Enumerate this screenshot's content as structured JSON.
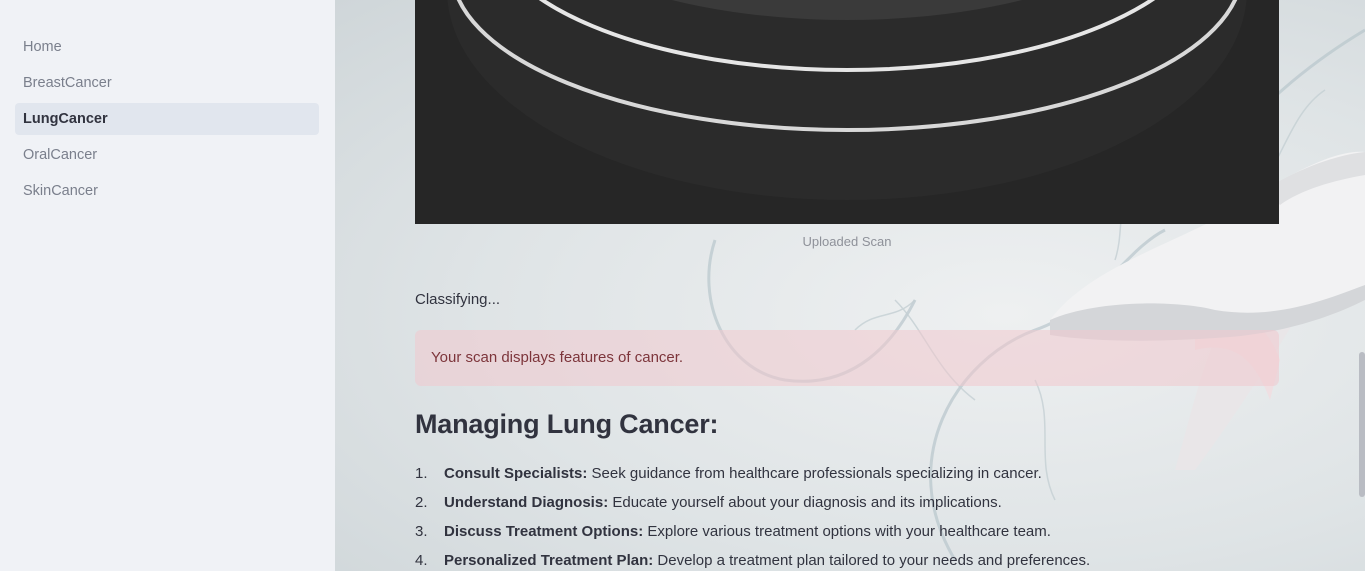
{
  "sidebar": {
    "items": [
      {
        "label": "Home"
      },
      {
        "label": "BreastCancer"
      },
      {
        "label": "LungCancer"
      },
      {
        "label": "OralCancer"
      },
      {
        "label": "SkinCancer"
      }
    ],
    "active_index": 2
  },
  "main": {
    "image_caption": "Uploaded Scan",
    "status_text": "Classifying...",
    "alert_text": "Your scan displays features of cancer.",
    "heading": "Managing Lung Cancer:",
    "steps": [
      {
        "number": "1.",
        "title": "Consult Specialists:",
        "text": " Seek guidance from healthcare professionals specializing in cancer."
      },
      {
        "number": "2.",
        "title": "Understand Diagnosis:",
        "text": " Educate yourself about your diagnosis and its implications."
      },
      {
        "number": "3.",
        "title": "Discuss Treatment Options:",
        "text": " Explore various treatment options with your healthcare team."
      },
      {
        "number": "4.",
        "title": "Personalized Treatment Plan:",
        "text": " Develop a treatment plan tailored to your needs and preferences."
      }
    ]
  },
  "colors": {
    "sidebar_bg": "#f0f2f6",
    "active_item_bg": "#e1e6ee",
    "alert_bg": "#f0c8cd",
    "alert_text": "#7d353b",
    "text": "#31333f"
  }
}
